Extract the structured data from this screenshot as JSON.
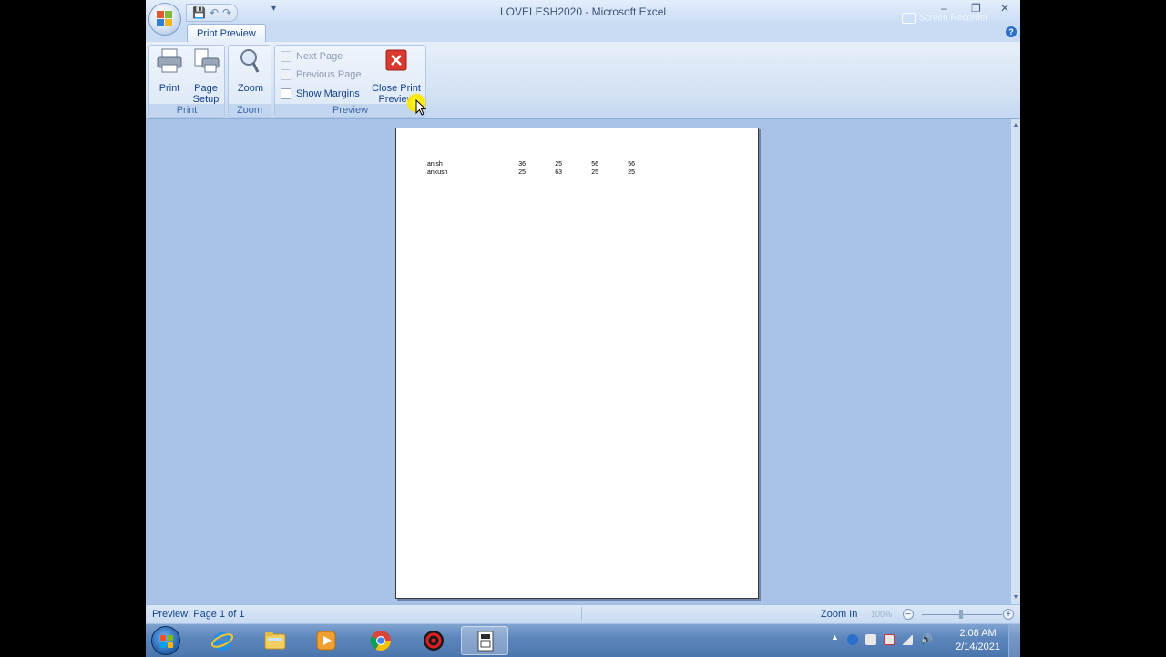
{
  "window": {
    "title": "LOVELESH2020 - Microsoft Excel",
    "controls": {
      "minimize": "–",
      "restore": "❐",
      "close": "✕"
    },
    "recorder_label": "Screen Recorder",
    "qat": {
      "save": "💾",
      "undo": "↶",
      "redo": "↷",
      "more": "▾"
    },
    "help": "?"
  },
  "ribbon": {
    "active_tab": "Print Preview",
    "groups": {
      "print": {
        "label": "Print",
        "print_button": "Print",
        "page_setup_line1": "Page",
        "page_setup_line2": "Setup"
      },
      "zoom": {
        "label": "Zoom",
        "zoom_button": "Zoom"
      },
      "preview": {
        "label": "Preview",
        "next_page": "Next Page",
        "previous_page": "Previous Page",
        "show_margins": "Show Margins",
        "close_line1": "Close Print",
        "close_line2": "Preview"
      }
    }
  },
  "sheet": {
    "rows": [
      {
        "name": "anish",
        "values": [
          "36",
          "25",
          "56",
          "56"
        ]
      },
      {
        "name": "ankush",
        "values": [
          "25",
          "63",
          "25",
          "25"
        ]
      }
    ]
  },
  "statusbar": {
    "status": "Preview: Page 1 of 1",
    "zoom_label": "Zoom In",
    "zoom_percent": "100%",
    "zoom_minus": "−",
    "zoom_plus": "+"
  },
  "taskbar": {
    "clock_time": "2:08 AM",
    "clock_date": "2/14/2021"
  },
  "colors": {
    "ribbon_text": "#15428b",
    "workspace": "#a9c3e6",
    "close_preview_red": "#d9392e"
  }
}
